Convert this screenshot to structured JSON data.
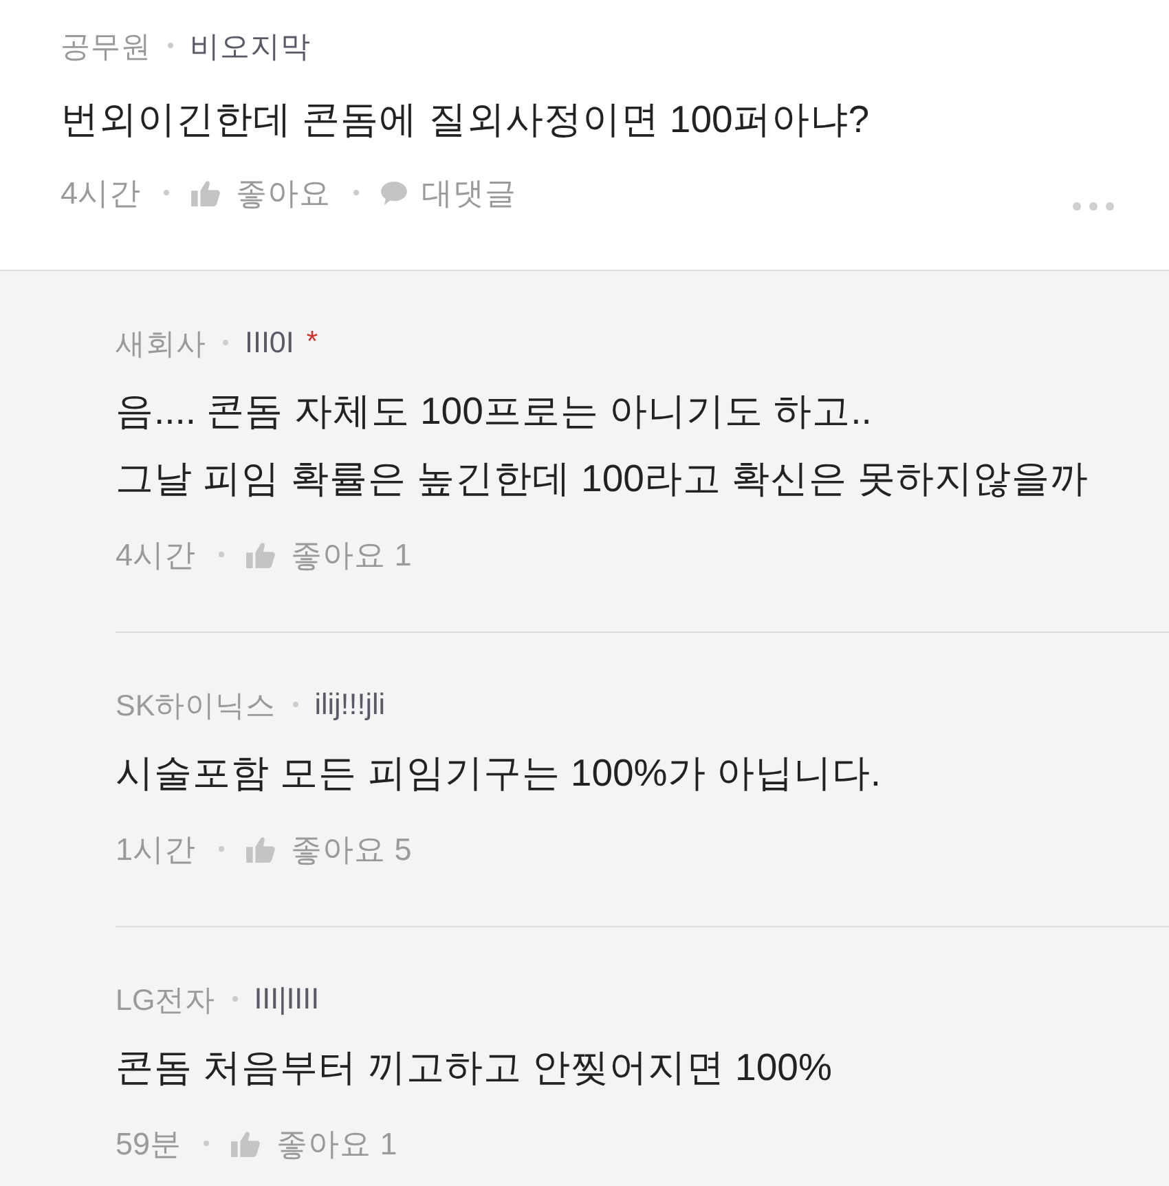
{
  "post": {
    "company": "공무원",
    "nickname": "비오지막",
    "text": "번외이긴한데 콘돔에 질외사정이면 100퍼아냐?",
    "time": "4시간",
    "like_label": "좋아요",
    "reply_label": "대댓글"
  },
  "replies": [
    {
      "company": "새회사",
      "nickname": "III0I",
      "mark": "*",
      "text": "음.... 콘돔 자체도 100프로는 아니기도 하고..\n그날 피임 확률은 높긴한데 100라고 확신은 못하지않을까",
      "time": "4시간",
      "like_label": "좋아요",
      "like_count": "1"
    },
    {
      "company": "SK하이닉스",
      "nickname": "ilij!!!jli",
      "text": "시술포함 모든 피임기구는 100%가 아닙니다.",
      "time": "1시간",
      "like_label": "좋아요",
      "like_count": "5"
    },
    {
      "company": "LG전자",
      "nickname": "III|IIII",
      "text": "콘돔 처음부터 끼고하고 안찢어지면 100%",
      "time": "59분",
      "like_label": "좋아요",
      "like_count": "1"
    }
  ]
}
